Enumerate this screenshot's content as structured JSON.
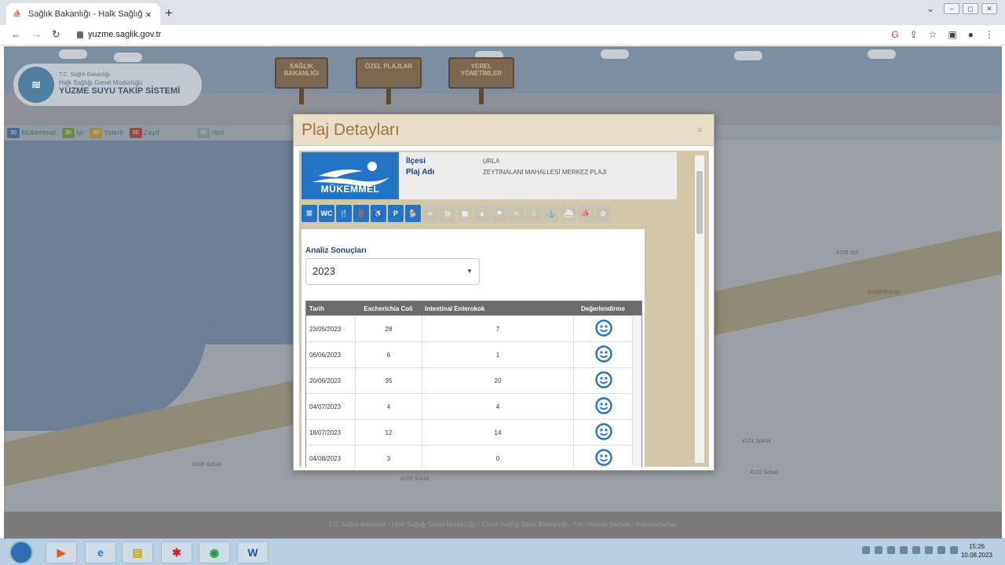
{
  "browser": {
    "tab_title": "Sağlık Bakanlığı - Halk Sağlığı Ge",
    "tab_close": "×",
    "new_tab": "+",
    "url": "yuzme.saglik.gov.tr"
  },
  "site": {
    "ministry": "T.C. Sağlık Bakanlığı",
    "directorate": "Halk Sağlığı Genel Müdürlüğü",
    "system_name": "YÜZME SUYU TAKİP SİSTEMİ",
    "signs": [
      "SAĞLIK BAKANLIĞI",
      "ÖZEL PLAJLAR",
      "YEREL YÖNETİMLER"
    ],
    "legend": [
      {
        "label": "Mükemmel",
        "color": "#4a6a95"
      },
      {
        "label": "İyi",
        "color": "#6c8a45"
      },
      {
        "label": "Yeterli",
        "color": "#a48c3a"
      },
      {
        "label": "Zayıf",
        "color": "#9c4a44"
      },
      {
        "label": "Yeni",
        "color": "#7d8c95"
      }
    ],
    "footer": "T.C. Sağlık Bakanlığı - Halk Sağlığı Genel Müdürlüğü - Çevre Sağlığı Daire Başkanlığı - Tüm Hakları Saklıdır - Kopyalanamaz",
    "streets": [
      "4155 Sol",
      "İsmail Bulvarı",
      "4105 Sokak",
      "4109 Sokak",
      "4131 Sokak",
      "4132 Sokak"
    ]
  },
  "modal": {
    "title": "Plaj Detayları",
    "close": "×",
    "status_label": "MÜKEMMEL",
    "fields": [
      {
        "label": "İlçesi",
        "value": "URLA"
      },
      {
        "label": "Plaj Adı",
        "value": "ZEYTİNALANI MAHALLESİ MERKEZ PLAJI"
      }
    ],
    "facility_icons": [
      {
        "name": "shower-icon",
        "glyph": "⛆",
        "active": true
      },
      {
        "name": "wc-icon",
        "glyph": "WC",
        "active": true
      },
      {
        "name": "restaurant-icon",
        "glyph": "🍴",
        "active": true
      },
      {
        "name": "changing-room-icon",
        "glyph": "🚪",
        "active": true
      },
      {
        "name": "wheelchair-icon",
        "glyph": "♿",
        "active": true
      },
      {
        "name": "parking-icon",
        "glyph": "P",
        "active": true
      },
      {
        "name": "pets-icon",
        "glyph": "🐕",
        "active": true
      },
      {
        "name": "binoculars-icon",
        "glyph": "∞",
        "active": false
      },
      {
        "name": "lifebuoy-icon",
        "glyph": "◎",
        "active": false
      },
      {
        "name": "camera-icon",
        "glyph": "▣",
        "active": false
      },
      {
        "name": "lifeguard-icon",
        "glyph": "▲",
        "active": false
      },
      {
        "name": "flag-icon",
        "glyph": "⚑",
        "active": false
      },
      {
        "name": "wave-icon",
        "glyph": "≈",
        "active": false
      },
      {
        "name": "tent-icon",
        "glyph": "⌂",
        "active": false
      },
      {
        "name": "anchor-icon",
        "glyph": "⚓",
        "active": false
      },
      {
        "name": "boat-icon",
        "glyph": "⛴",
        "active": false
      },
      {
        "name": "jetski-icon",
        "glyph": "⛵",
        "active": false
      },
      {
        "name": "smoke-free-icon",
        "glyph": "⊘",
        "active": false
      }
    ],
    "analysis_title": "Analiz Sonuçları",
    "year_selected": "2023",
    "table": {
      "headers": [
        "Tarih",
        "Escherichia Coli",
        "Intestinal Enterokok",
        "Değerlendirme"
      ],
      "rows": [
        {
          "date": "23/05/2023",
          "ecoli": "28",
          "entero": "7",
          "rating": "smiley-icon"
        },
        {
          "date": "06/06/2023",
          "ecoli": "6",
          "entero": "1",
          "rating": "smiley-icon"
        },
        {
          "date": "20/06/2023",
          "ecoli": "35",
          "entero": "20",
          "rating": "smiley-icon"
        },
        {
          "date": "04/07/2023",
          "ecoli": "4",
          "entero": "4",
          "rating": "smiley-icon"
        },
        {
          "date": "18/07/2023",
          "ecoli": "12",
          "entero": "14",
          "rating": "smiley-icon"
        },
        {
          "date": "04/08/2023",
          "ecoli": "3",
          "entero": "0",
          "rating": "smiley-icon"
        }
      ]
    }
  },
  "taskbar": {
    "time": "15:26",
    "date": "10.08.2023"
  }
}
